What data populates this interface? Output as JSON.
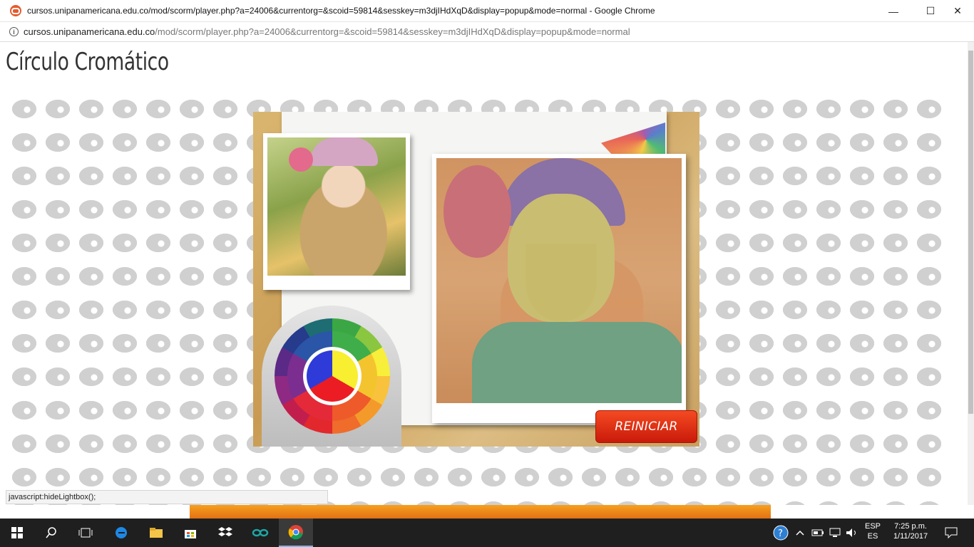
{
  "window": {
    "title": "cursos.unipanamericana.edu.co/mod/scorm/player.php?a=24006&currentorg=&scoid=59814&sesskey=m3djIHdXqD&display=popup&mode=normal - Google Chrome",
    "minimize": "—",
    "maximize": "☐",
    "close": "✕"
  },
  "address": {
    "host": "cursos.unipanamericana.edu.co",
    "path": "/mod/scorm/player.php?a=24006&currentorg=&scoid=59814&sesskey=m3djIHdXqD&display=popup&mode=normal"
  },
  "page": {
    "title": "Círculo Cromático",
    "reset_label": "REINICIAR"
  },
  "status_bar": {
    "text": "javascript:hideLightbox();"
  },
  "taskbar": {
    "language_top": "ESP",
    "language_bottom": "ES",
    "time": "7:25 p.m.",
    "date": "1/11/2017"
  }
}
